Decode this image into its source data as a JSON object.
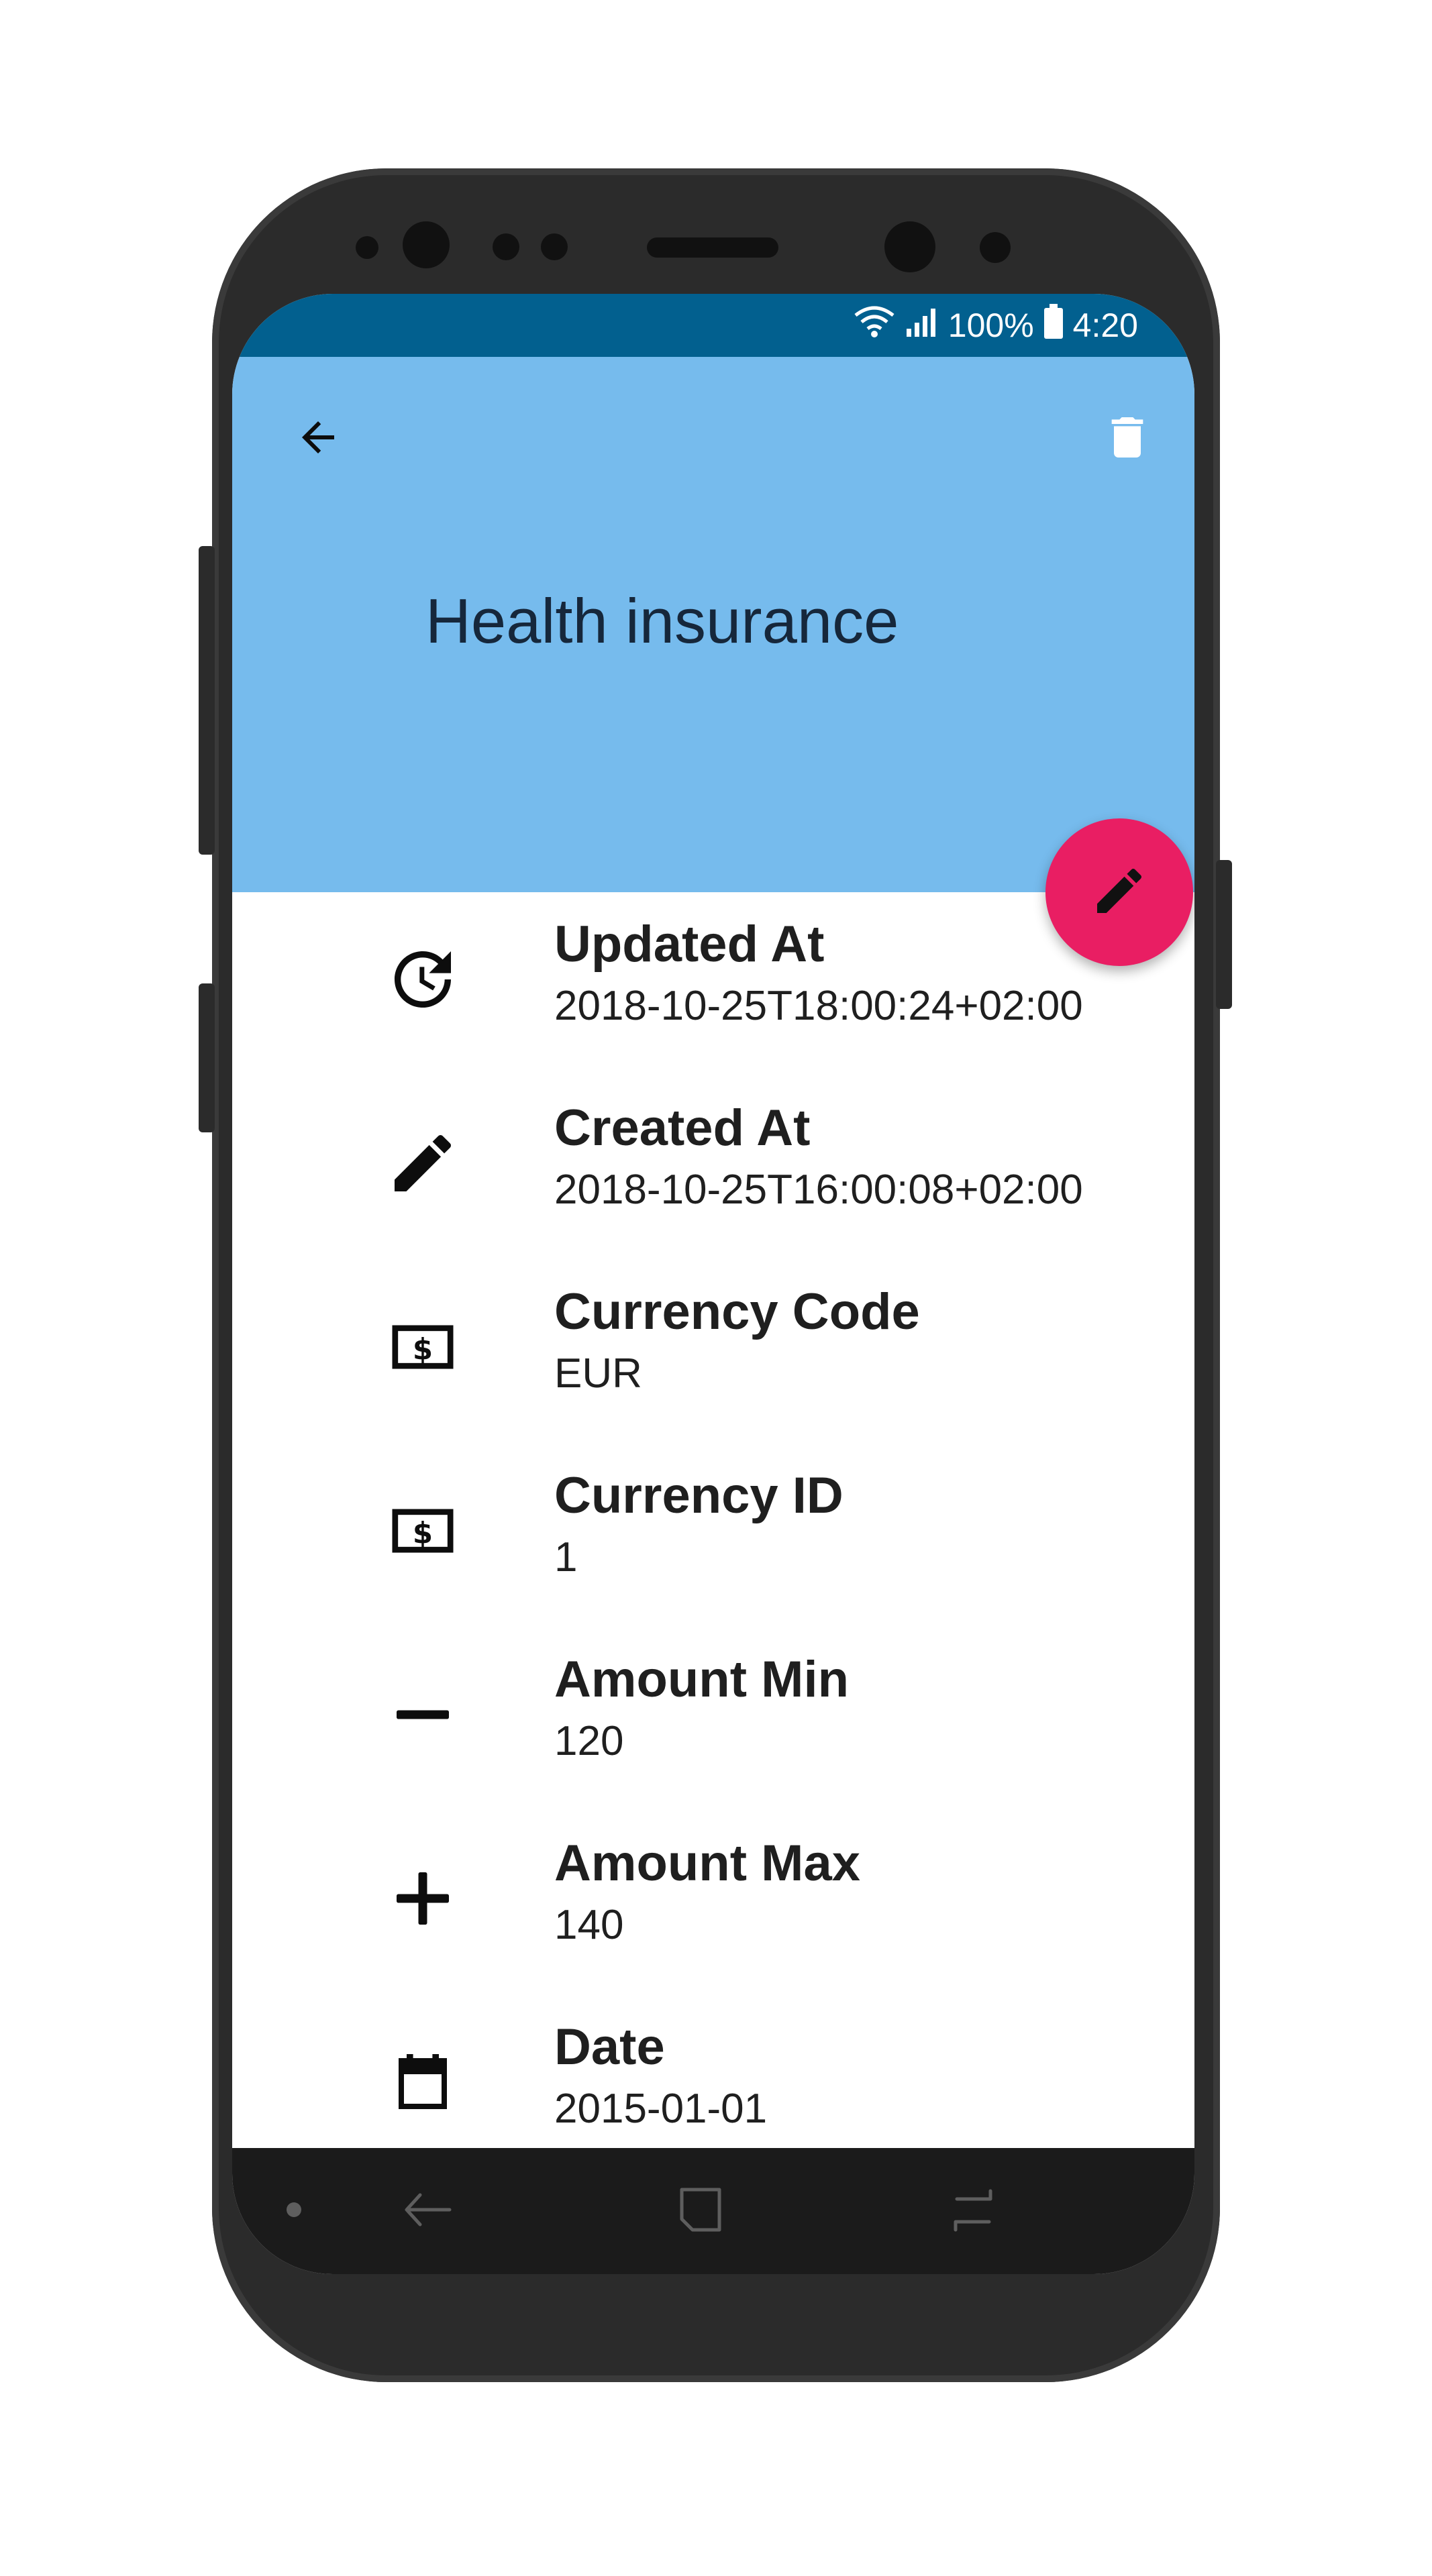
{
  "status_bar": {
    "battery": "100%",
    "time": "4:20",
    "background": "#02608f"
  },
  "app_bar": {
    "title": "Health insurance",
    "background": "#76bbed",
    "back_icon": "arrow-back-icon",
    "delete_icon": "trash-icon"
  },
  "fab": {
    "icon": "pencil-icon",
    "color": "#e91e63"
  },
  "details": [
    {
      "icon": "clock-update-icon",
      "label": "Updated At",
      "value": "2018-10-25T18:00:24+02:00"
    },
    {
      "icon": "pencil-icon",
      "label": "Created At",
      "value": "2018-10-25T16:00:08+02:00"
    },
    {
      "icon": "dollar-bill-icon",
      "label": "Currency Code",
      "value": "EUR"
    },
    {
      "icon": "dollar-bill-icon",
      "label": "Currency ID",
      "value": "1"
    },
    {
      "icon": "minus-icon",
      "label": "Amount Min",
      "value": "120"
    },
    {
      "icon": "plus-icon",
      "label": "Amount Max",
      "value": "140"
    },
    {
      "icon": "calendar-icon",
      "label": "Date",
      "value": "2015-01-01"
    }
  ],
  "nav_bar": {
    "items": [
      "dot-icon",
      "back-icon",
      "recents-icon",
      "home-icon"
    ]
  }
}
